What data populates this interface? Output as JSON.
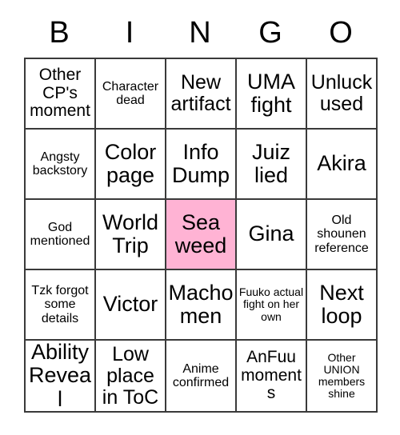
{
  "header": {
    "letters": [
      "B",
      "I",
      "N",
      "G",
      "O"
    ]
  },
  "colors": {
    "marked": "#ffb3d4",
    "grid_line": "#3a3a3a",
    "background": "#ffffff",
    "text": "#000000"
  },
  "grid": {
    "rows": 5,
    "columns": 5,
    "cells": [
      {
        "text": "Other CP's moment",
        "marked": false,
        "size": "md"
      },
      {
        "text": "Character dead",
        "marked": false,
        "size": "sm"
      },
      {
        "text": "New artifact",
        "marked": false,
        "size": "lg"
      },
      {
        "text": "UMA fight",
        "marked": false,
        "size": "xl"
      },
      {
        "text": "Unluck used",
        "marked": false,
        "size": "lg"
      },
      {
        "text": "Angsty backstory",
        "marked": false,
        "size": "sm"
      },
      {
        "text": "Color page",
        "marked": false,
        "size": "xl"
      },
      {
        "text": "Info Dump",
        "marked": false,
        "size": "xl"
      },
      {
        "text": "Juiz lied",
        "marked": false,
        "size": "xl"
      },
      {
        "text": "Akira",
        "marked": false,
        "size": "xl"
      },
      {
        "text": "God mentioned",
        "marked": false,
        "size": "sm"
      },
      {
        "text": "World Trip",
        "marked": false,
        "size": "xl"
      },
      {
        "text": "Sea weed",
        "marked": true,
        "size": "xl"
      },
      {
        "text": "Gina",
        "marked": false,
        "size": "xl"
      },
      {
        "text": "Old shounen reference",
        "marked": false,
        "size": "sm"
      },
      {
        "text": "Tzk forgot some details",
        "marked": false,
        "size": "sm"
      },
      {
        "text": "Victor",
        "marked": false,
        "size": "xl"
      },
      {
        "text": "Macho men",
        "marked": false,
        "size": "xl"
      },
      {
        "text": "Fuuko actual fight on her own",
        "marked": false,
        "size": "xs"
      },
      {
        "text": "Next loop",
        "marked": false,
        "size": "xl"
      },
      {
        "text": "Ability Reveal",
        "marked": false,
        "size": "xl"
      },
      {
        "text": "Low place in ToC",
        "marked": false,
        "size": "lg"
      },
      {
        "text": "Anime confirmed",
        "marked": false,
        "size": "sm"
      },
      {
        "text": "AnFuu moments",
        "marked": false,
        "size": "md"
      },
      {
        "text": "Other UNION members shine",
        "marked": false,
        "size": "xs"
      }
    ]
  }
}
